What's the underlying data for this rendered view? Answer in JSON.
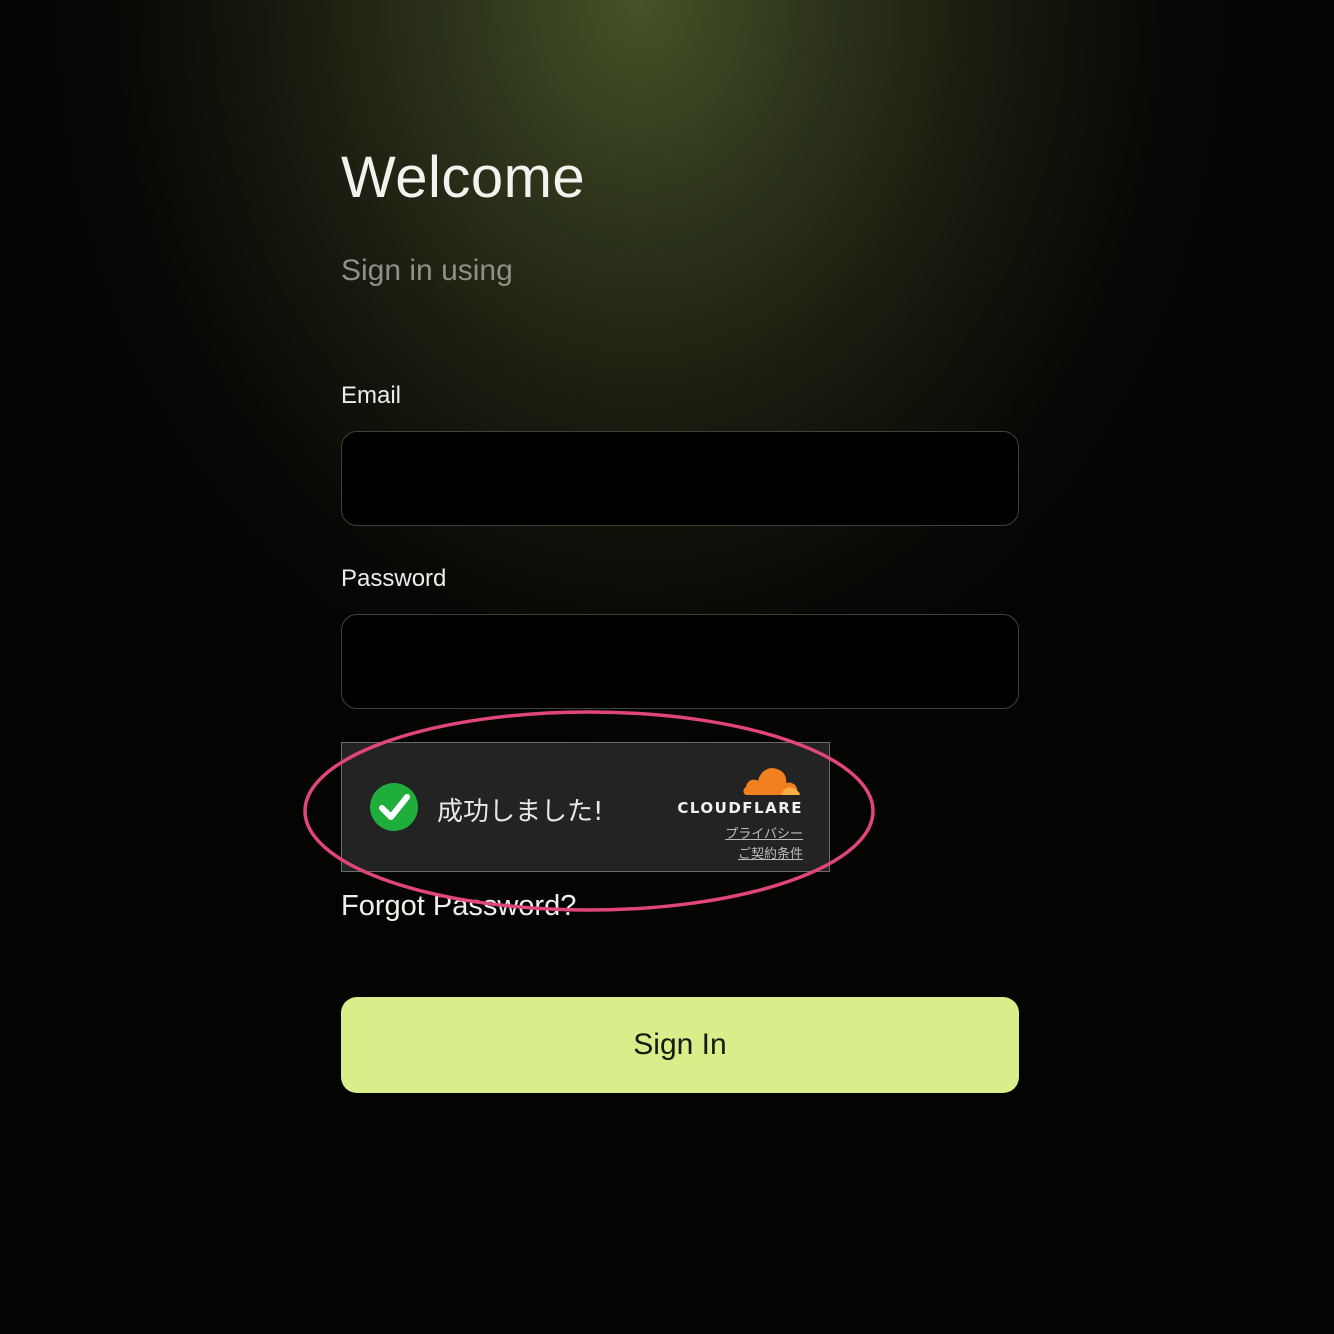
{
  "header": {
    "title": "Welcome",
    "subtitle": "Sign in using"
  },
  "form": {
    "email_label": "Email",
    "email_value": "",
    "password_label": "Password",
    "password_value": "",
    "forgot_label": "Forgot Password?",
    "submit_label": "Sign In"
  },
  "captcha": {
    "status_text": "成功しました!",
    "status": "success",
    "brand": "CLOUDFLARE",
    "privacy_link": "プライバシー",
    "terms_link": "ご契約条件",
    "icon": "check-circle-icon",
    "brand_icon": "cloudflare-cloud-icon"
  },
  "colors": {
    "accent_button": "#d7ee8a",
    "success_green": "#1fae3c",
    "cloudflare_orange": "#f38020",
    "annotation_ring": "#e0457d"
  }
}
